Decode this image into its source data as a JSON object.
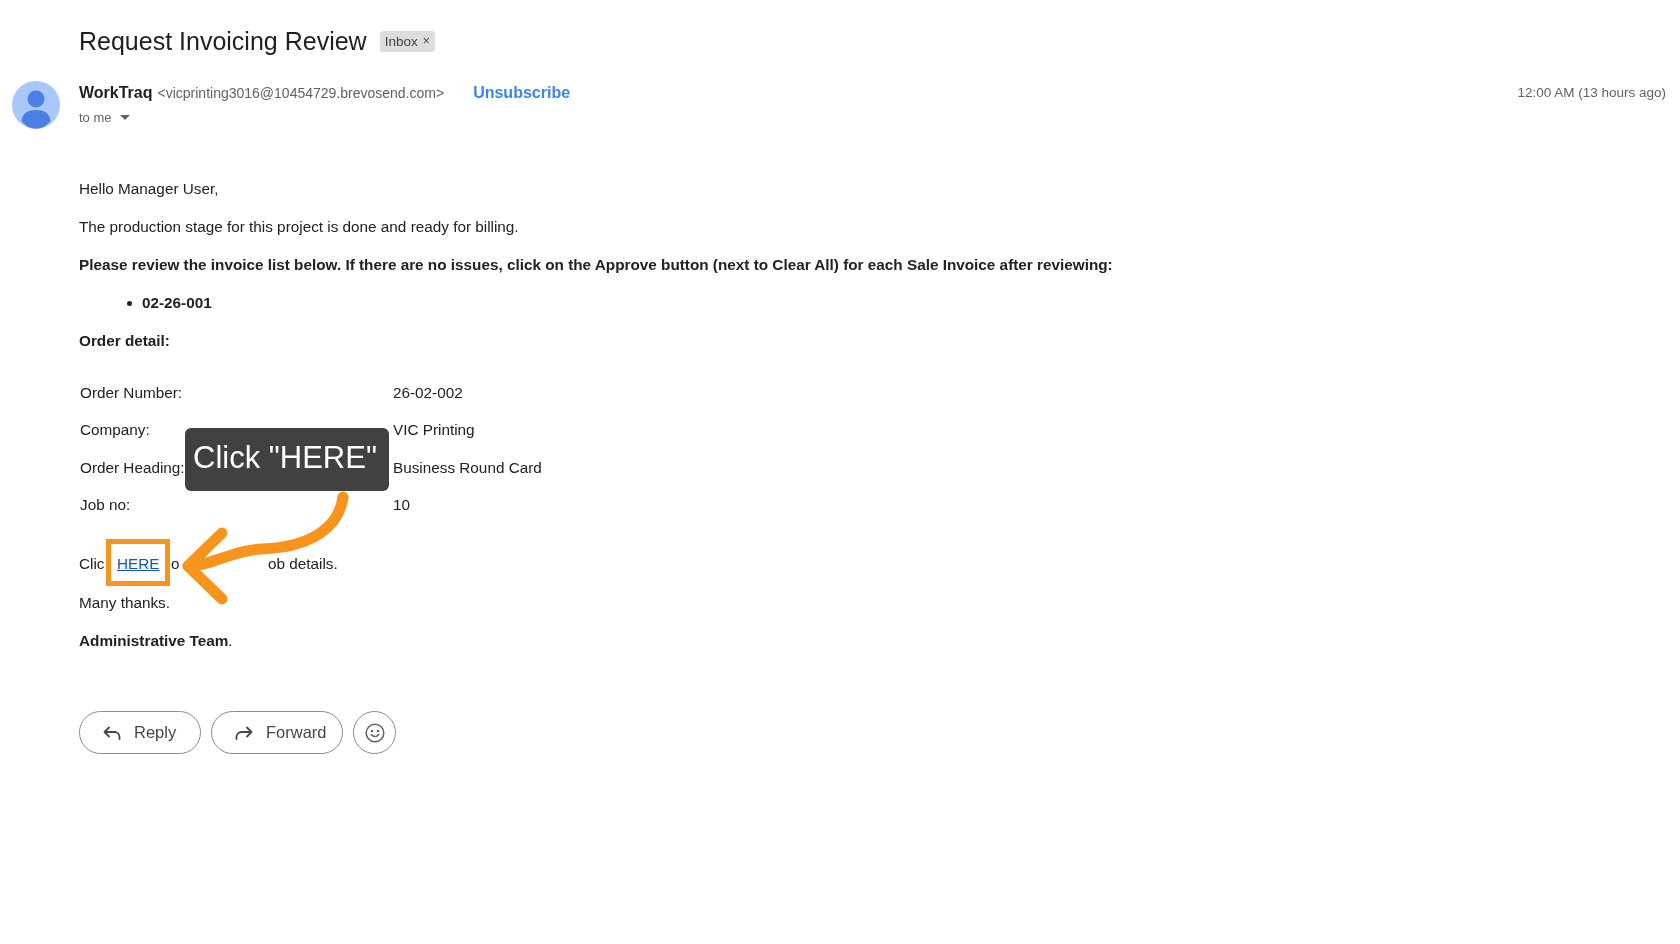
{
  "message": {
    "subject": "Request Invoicing Review",
    "labels": [
      {
        "label": "Inbox",
        "remove": "×"
      }
    ],
    "sender": {
      "name": "WorkTraq",
      "email": "<vicprinting3016@10454729.brevosend.com>",
      "unsubscribe": "Unsubscribe",
      "recipient": "to me"
    },
    "received": "12:00 AM (13 hours ago)",
    "body": {
      "greeting": "Hello Manager User,",
      "intro": "The production stage for this project is done and ready for billing.",
      "instruction": "Please review the invoice list below. If there are no issues, click on the Approve button (next to Clear All) for each Sale Invoice after reviewing:",
      "invoices": [
        "02-26-001"
      ],
      "order_heading": "Order detail:",
      "order_details": [
        {
          "label": "Order Number:",
          "value": "26-02-002"
        },
        {
          "label": "Company:",
          "value": "VIC Printing"
        },
        {
          "label": "Order Heading:",
          "value": "Business Round Card"
        },
        {
          "label": "Job no:",
          "value": "10"
        }
      ],
      "link_line": {
        "text_before": "Clic",
        "link": "HERE",
        "visible_text_after": [
          "o",
          "ob details."
        ]
      },
      "thanks": "Many thanks.",
      "signature": "**Administrative Team**."
    },
    "actions": [
      {
        "kind": "reply",
        "label": "Reply"
      },
      {
        "kind": "forward",
        "label": "Forward"
      },
      {
        "kind": "emoji"
      }
    ]
  },
  "annotation": {
    "callout": "Click \"HERE\""
  }
}
